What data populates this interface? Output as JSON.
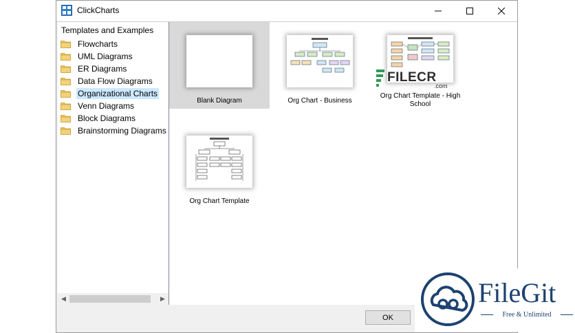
{
  "window": {
    "title": "ClickCharts",
    "icons": {
      "app": "clickcharts-app-icon",
      "minimize": "minimize-icon",
      "maximize": "maximize-icon",
      "close": "close-icon"
    }
  },
  "left_panel": {
    "heading": "Templates and Examples",
    "items": [
      {
        "label": "Flowcharts"
      },
      {
        "label": "UML Diagrams"
      },
      {
        "label": "ER Diagrams"
      },
      {
        "label": "Data Flow Diagrams"
      },
      {
        "label": "Organizational Charts",
        "selected": true
      },
      {
        "label": "Venn Diagrams"
      },
      {
        "label": "Block Diagrams"
      },
      {
        "label": "Brainstorming Diagrams"
      }
    ],
    "item_icon": "folder-icon"
  },
  "templates": [
    {
      "label": "Blank Diagram",
      "selected": true
    },
    {
      "label": "Org Chart - Business"
    },
    {
      "label": "Org Chart Template - High School"
    },
    {
      "label": "Org Chart Template"
    }
  ],
  "footer": {
    "ok_label": "OK"
  },
  "watermarks": {
    "filecr": {
      "text": "FILECR",
      "suffix": ".com"
    },
    "filegit": {
      "name": "FileGit",
      "tagline": "Free & Unlimited"
    }
  },
  "colors": {
    "selection": "#cce8ff",
    "folder": "#e8c35b",
    "filegit_brand": "#1c4270",
    "filecr_green": "#2e9b56"
  }
}
